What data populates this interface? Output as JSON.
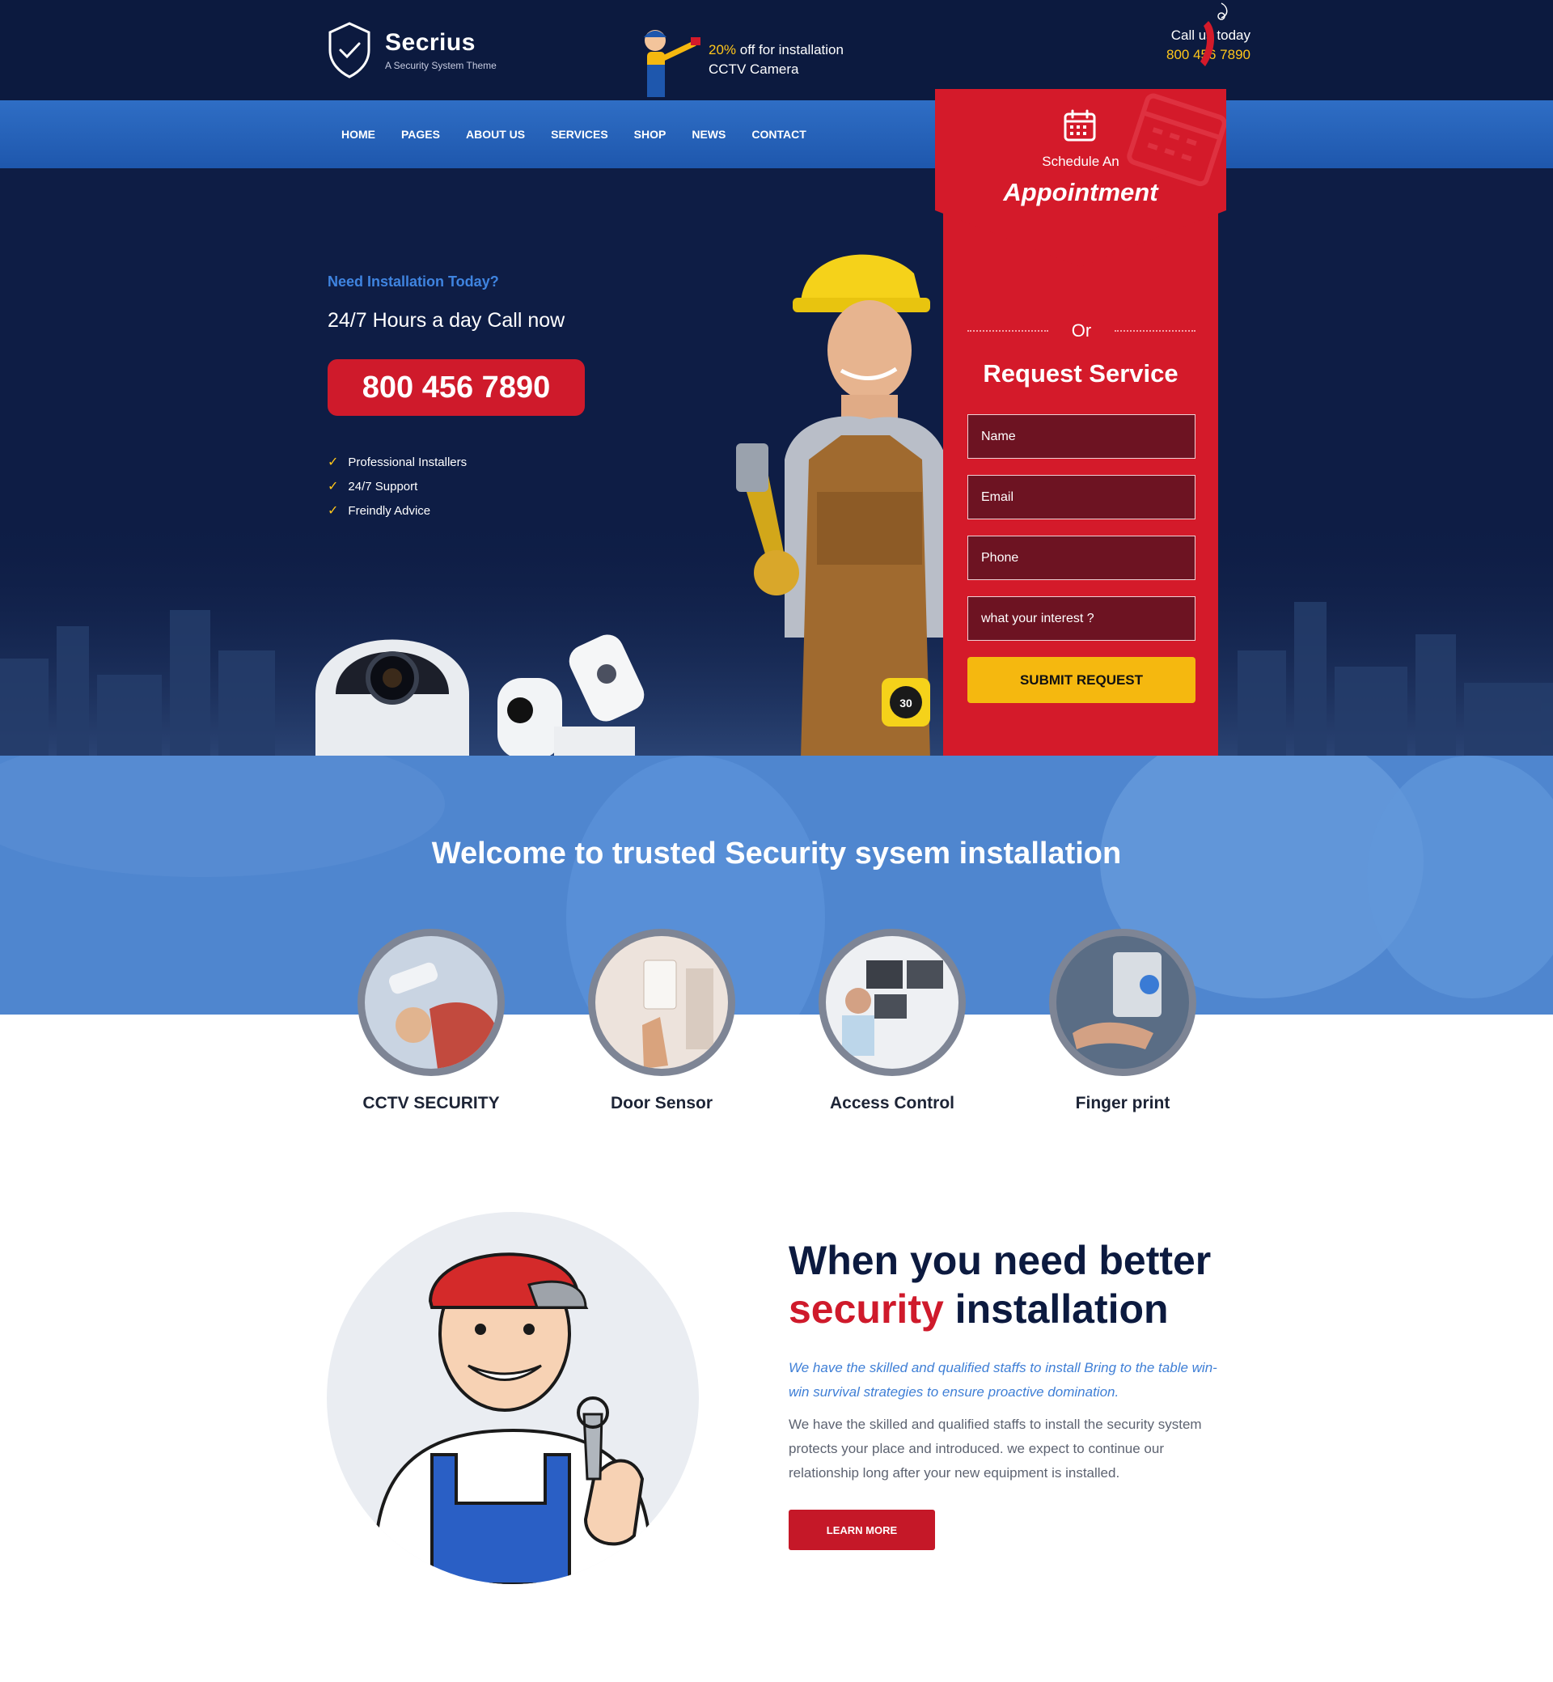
{
  "brand": {
    "name": "Secrius",
    "tagline": "A Security System Theme"
  },
  "promo": {
    "percent": "20%",
    "line1_rest": " off for installation",
    "line2": "CCTV Camera"
  },
  "call": {
    "label": "Call us today",
    "number": "800 456 7890"
  },
  "nav": {
    "items": [
      "HOME",
      "PAGES",
      "ABOUT US",
      "SERVICES",
      "SHOP",
      "NEWS",
      "CONTACT"
    ]
  },
  "hero": {
    "subtitle": "Need Installation Today?",
    "call_text": "24/7 Hours a day Call now",
    "phone_button": "800 456 7890",
    "features": [
      "Professional Installers",
      "24/7 Support",
      "Freindly Advice"
    ]
  },
  "appointment": {
    "schedule_small": "Schedule An",
    "schedule_big": "Appointment",
    "or": "Or",
    "request_title": "Request Service",
    "fields": {
      "name": "Name",
      "email": "Email",
      "phone": "Phone",
      "interest": "what your interest ?"
    },
    "submit": "SUBMIT REQUEST"
  },
  "welcome": {
    "title": "Welcome to trusted Security sysem installation"
  },
  "services": [
    "CCTV SECURITY",
    "Door Sensor",
    "Access Control",
    "Finger print"
  ],
  "about": {
    "title_line1": "When you need better",
    "title_red": "security",
    "title_rest": " installation",
    "italic": "We have the skilled and qualified staffs to install Bring to the table win-win survival strategies to ensure proactive domination.",
    "body": "We have the skilled and qualified staffs to install the security system protects your place and introduced. we expect to continue our relationship long after your new equipment is installed.",
    "button": "LEARN MORE"
  },
  "colors": {
    "navy": "#0c1a3f",
    "blue": "#2f6ec5",
    "red": "#cf1a2b",
    "yellow": "#f5b80f"
  }
}
